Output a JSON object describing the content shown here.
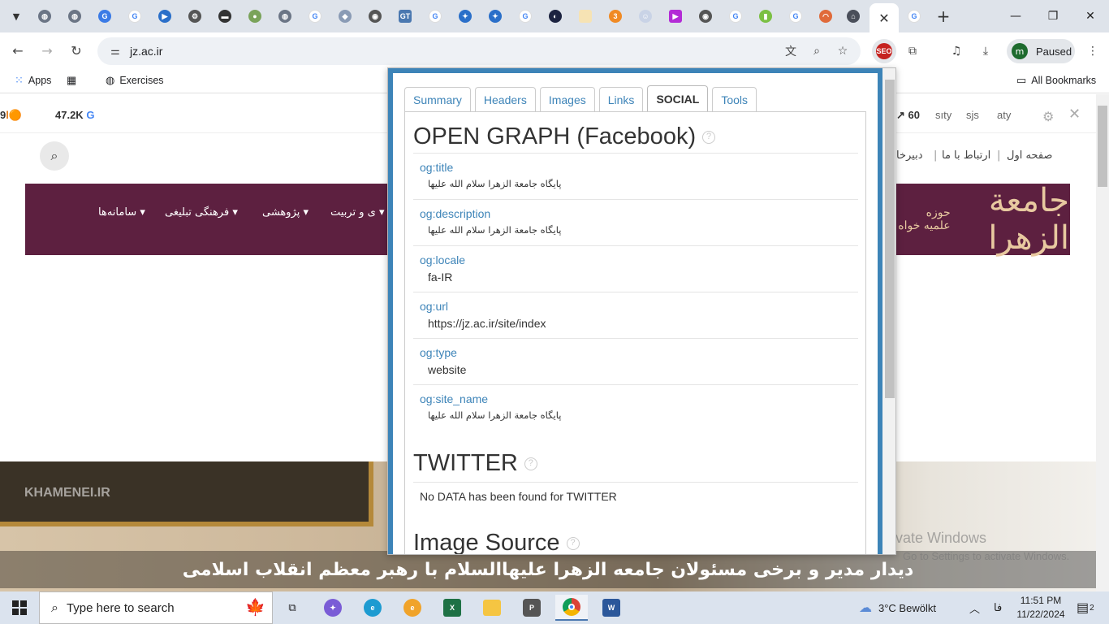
{
  "browser": {
    "url": "jz.ac.ir",
    "profile_label": "Paused",
    "profile_initial": "m",
    "extension_badge": "SEO",
    "tab_badge_count": "3"
  },
  "bookmarks": {
    "apps_label": "Apps",
    "exercises_label": "Exercises",
    "all_bookmarks_label": "All Bookmarks"
  },
  "seobar": {
    "left_value": "9",
    "google_count": "47.2K",
    "right_value": "60"
  },
  "site": {
    "top_links": [
      "صفحه اول",
      "ارتباط با ما",
      "دبیرخا"
    ],
    "nav_items": [
      "سامانه‌ها",
      "فرهنگی تبلیغی",
      "پژوهشی",
      "ی و تربیت"
    ],
    "logo_text": "جامعة الزهرا",
    "logo_side_text": "حوزه علمیه خواه",
    "slider_watermark": "KHAMENEI.IR",
    "slider_caption": "دیدار مدیر و برخی مسئولان جامعه الزهرا علیهاالسلام با رهبر معظم انقلاب اسلامی",
    "activate_title": "Activate Windows",
    "activate_sub": "Go to Settings to activate Windows."
  },
  "popup": {
    "tabs": [
      "Summary",
      "Headers",
      "Images",
      "Links",
      "SOCIAL",
      "Tools"
    ],
    "og_heading": "OPEN GRAPH (Facebook)",
    "og_rows": [
      {
        "key": "og:title",
        "value": "پایگاه جامعة الزهرا سلام الله علیها"
      },
      {
        "key": "og:description",
        "value": "پایگاه جامعة الزهرا سلام الله علیها"
      },
      {
        "key": "og:locale",
        "value": "fa-IR"
      },
      {
        "key": "og:url",
        "value": "https://jz.ac.ir/site/index"
      },
      {
        "key": "og:type",
        "value": "website"
      },
      {
        "key": "og:site_name",
        "value": "پایگاه جامعة الزهرا سلام الله علیها"
      }
    ],
    "twitter_heading": "TWITTER",
    "twitter_message": "No DATA has been found for TWITTER",
    "image_source_heading": "Image Source"
  },
  "taskbar": {
    "search_placeholder": "Type here to search",
    "weather": "3°C  Bewölkt",
    "lang": "فا",
    "time": "11:51 PM",
    "date": "11/22/2024",
    "notifications": "2"
  },
  "colors": {
    "accent": "#3d84b8",
    "banner": "#5d2040",
    "chrome_tabstrip": "#dee3ea"
  }
}
